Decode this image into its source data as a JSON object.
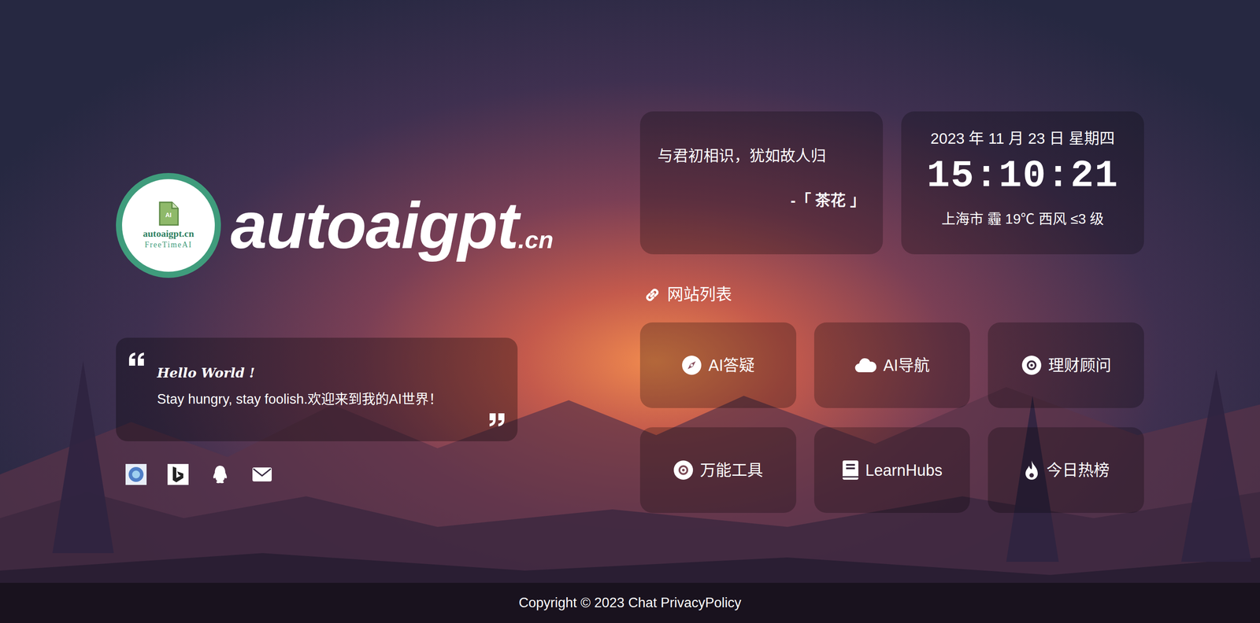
{
  "logo": {
    "badge": "AI",
    "domain": "autoaigpt.cn",
    "slogan": "FreeTimeAI"
  },
  "brand": {
    "name": "autoaigpt",
    "suffix": ".cn"
  },
  "quote": {
    "title": "Hello World !",
    "text": "Stay hungry, stay foolish.欢迎来到我的AI世界！"
  },
  "motto": {
    "text": "与君初相识，犹如故人归",
    "author": "-「 茶花 」"
  },
  "clock": {
    "date": "2023 年 11 月 23 日 星期四",
    "time": "15:10:21",
    "weather": "上海市 霾 19℃ 西风 ≤3 级"
  },
  "sites": {
    "title": "网站列表",
    "items": [
      {
        "label": "AI答疑"
      },
      {
        "label": "AI导航"
      },
      {
        "label": "理财顾问"
      },
      {
        "label": "万能工具"
      },
      {
        "label": "LearnHubs"
      },
      {
        "label": "今日热榜"
      }
    ]
  },
  "footer": {
    "text": "Copyright © 2023 Chat PrivacyPolicy"
  }
}
